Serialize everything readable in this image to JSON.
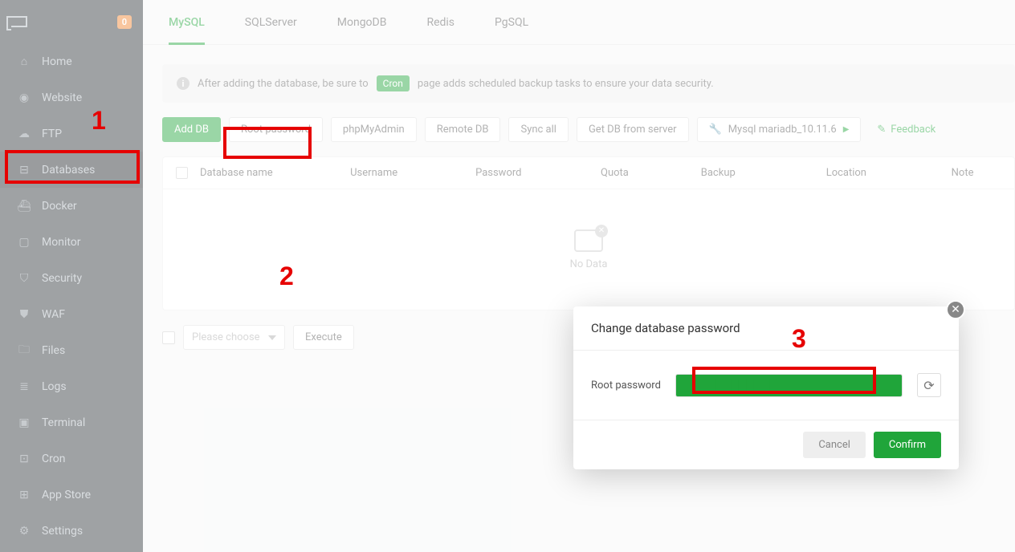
{
  "sidebar": {
    "badge": "0",
    "items": [
      {
        "label": "Home"
      },
      {
        "label": "Website"
      },
      {
        "label": "FTP"
      },
      {
        "label": "Databases"
      },
      {
        "label": "Docker"
      },
      {
        "label": "Monitor"
      },
      {
        "label": "Security"
      },
      {
        "label": "WAF"
      },
      {
        "label": "Files"
      },
      {
        "label": "Logs"
      },
      {
        "label": "Terminal"
      },
      {
        "label": "Cron"
      },
      {
        "label": "App Store"
      },
      {
        "label": "Settings"
      }
    ]
  },
  "tabs": [
    "MySQL",
    "SQLServer",
    "MongoDB",
    "Redis",
    "PgSQL"
  ],
  "info": {
    "pre": "After adding the database, be sure to",
    "cron": "Cron",
    "post": "page adds scheduled backup tasks to ensure your data security."
  },
  "toolbar": {
    "add": "Add DB",
    "root": "Root password",
    "pma": "phpMyAdmin",
    "remote": "Remote DB",
    "sync": "Sync all",
    "get": "Get DB from server",
    "mysql": "Mysql mariadb_10.11.6",
    "feedback": "Feedback"
  },
  "columns": [
    "Database name",
    "Username",
    "Password",
    "Quota",
    "Backup",
    "Location",
    "Note"
  ],
  "empty": "No Data",
  "bulk": {
    "placeholder": "Please choose",
    "execute": "Execute"
  },
  "modal": {
    "title": "Change database password",
    "label": "Root password",
    "value": "████████████",
    "cancel": "Cancel",
    "confirm": "Confirm"
  },
  "annotations": {
    "one": "1",
    "two": "2",
    "three": "3"
  }
}
